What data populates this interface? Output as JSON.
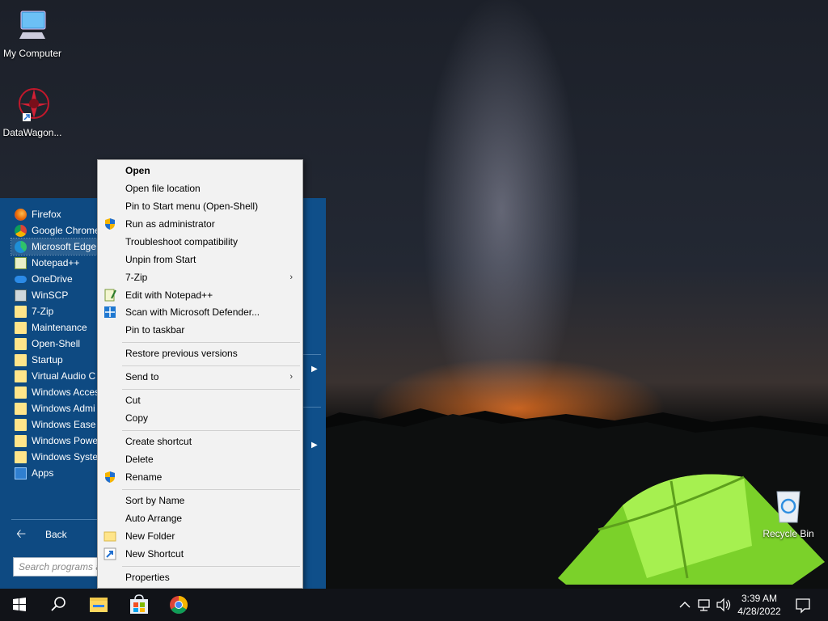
{
  "desktop": {
    "icons": [
      {
        "label": "My Computer",
        "icon": "computer-icon"
      },
      {
        "label": "DataWagon...",
        "icon": "datawagon-shortcut-icon"
      },
      {
        "label": "Recycle Bin",
        "icon": "recycle-bin-icon"
      }
    ]
  },
  "start_menu": {
    "programs": [
      {
        "label": "Firefox",
        "icon": "firefox-icon"
      },
      {
        "label": "Google Chrome",
        "icon": "chrome-icon"
      },
      {
        "label": "Microsoft Edge",
        "icon": "edge-icon"
      },
      {
        "label": "Notepad++",
        "icon": "notepadpp-icon"
      },
      {
        "label": "OneDrive",
        "icon": "onedrive-icon"
      },
      {
        "label": "WinSCP",
        "icon": "winscp-icon"
      },
      {
        "label": "7-Zip",
        "icon": "folder-icon"
      },
      {
        "label": "Maintenance",
        "icon": "folder-icon"
      },
      {
        "label": "Open-Shell",
        "icon": "folder-icon"
      },
      {
        "label": "Startup",
        "icon": "folder-icon"
      },
      {
        "label": "Virtual Audio C",
        "icon": "folder-icon"
      },
      {
        "label": "Windows Access",
        "icon": "folder-icon"
      },
      {
        "label": "Windows Admi",
        "icon": "folder-icon"
      },
      {
        "label": "Windows Ease o",
        "icon": "folder-icon"
      },
      {
        "label": "Windows Powe",
        "icon": "folder-icon"
      },
      {
        "label": "Windows Syster",
        "icon": "folder-icon"
      },
      {
        "label": "Apps",
        "icon": "apps-icon"
      }
    ],
    "back_label": "Back",
    "search_placeholder": "Search programs a"
  },
  "context_menu": {
    "items": [
      {
        "label": "Open",
        "bold": true
      },
      {
        "label": "Open file location"
      },
      {
        "label": "Pin to Start menu (Open-Shell)"
      },
      {
        "label": "Run as administrator",
        "icon": "uac-shield-icon"
      },
      {
        "label": "Troubleshoot compatibility"
      },
      {
        "label": "Unpin from Start"
      },
      {
        "label": "7-Zip",
        "submenu": true
      },
      {
        "label": "Edit with Notepad++",
        "icon": "notepadpp-icon"
      },
      {
        "label": "Scan with Microsoft Defender...",
        "icon": "defender-icon"
      },
      {
        "label": "Pin to taskbar"
      },
      {
        "label": "Restore previous versions"
      },
      {
        "label": "Send to",
        "submenu": true
      },
      {
        "label": "Cut"
      },
      {
        "label": "Copy"
      },
      {
        "label": "Create shortcut"
      },
      {
        "label": "Delete"
      },
      {
        "label": "Rename",
        "icon": "uac-shield-icon"
      },
      {
        "label": "Sort by Name"
      },
      {
        "label": "Auto Arrange"
      },
      {
        "label": "New Folder",
        "icon": "folder-icon"
      },
      {
        "label": "New Shortcut",
        "icon": "shortcut-icon"
      },
      {
        "label": "Properties"
      }
    ],
    "submenu_arrow": "›"
  },
  "taskbar": {
    "buttons": [
      "start-icon",
      "search-icon",
      "file-explorer-icon",
      "store-icon",
      "chrome-icon"
    ],
    "tray": [
      "chevron-up-icon",
      "network-icon",
      "volume-icon"
    ],
    "clock_time": "3:39 AM",
    "clock_date": "4/28/2022",
    "notification_icon": "notification-icon"
  },
  "colors": {
    "start_menu_bg": "#0f4f8a",
    "context_bg": "#f2f2f2",
    "taskbar_bg": "#111318",
    "tent": "#8fe03a"
  }
}
